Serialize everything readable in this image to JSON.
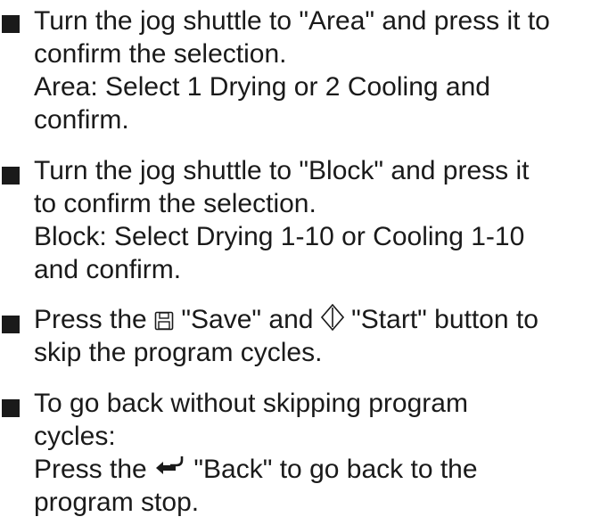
{
  "steps": [
    {
      "lines": [
        "Turn the jog shuttle to \"Area\" and press it to",
        "confirm the selection.",
        "Area: Select 1 Drying or 2 Cooling and",
        "confirm."
      ]
    },
    {
      "lines": [
        "Turn the jog shuttle to \"Block\" and press it",
        "to confirm the selection.",
        "Block: Select Drying 1-10 or Cooling 1-10",
        "and confirm."
      ]
    },
    {
      "line1_prefix": "Press the ",
      "save_label": " \"Save\" and ",
      "start_label": " \"Start\" button to",
      "save_icon": "save-icon",
      "start_icon": "start-icon",
      "line2": "skip the program cycles."
    },
    {
      "line1": "To go back without skipping program",
      "line2": "cycles:",
      "line3_prefix": "Press the ",
      "line3_suffix": " \"Back\" to go back to the",
      "back_icon": "back-icon",
      "line4": "program stop."
    }
  ]
}
